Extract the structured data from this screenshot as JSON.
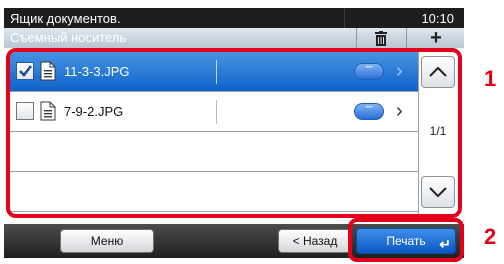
{
  "header": {
    "title": "Ящик документов.",
    "time": "10:10",
    "subtitle": "Съемный носитель",
    "delete_icon": "trash-icon",
    "add_icon": "plus-icon",
    "add_label": "+"
  },
  "files": [
    {
      "name": "11-3-3.JPG",
      "checked": true,
      "selected": true
    },
    {
      "name": "7-9-2.JPG",
      "checked": false,
      "selected": false
    }
  ],
  "scroll": {
    "up_icon": "chevron-up-icon",
    "down_icon": "chevron-down-icon",
    "page": "1/1"
  },
  "callouts": {
    "first": "1",
    "second": "2"
  },
  "footer": {
    "menu_label": "Меню",
    "back_label": "< Назад",
    "print_label": "Печать",
    "enter_icon": "enter-icon",
    "enter_glyph": "↵"
  },
  "colors": {
    "highlight": "#e2001a",
    "selected_row": "#1a6fd3",
    "accent": "#0a56c2"
  }
}
